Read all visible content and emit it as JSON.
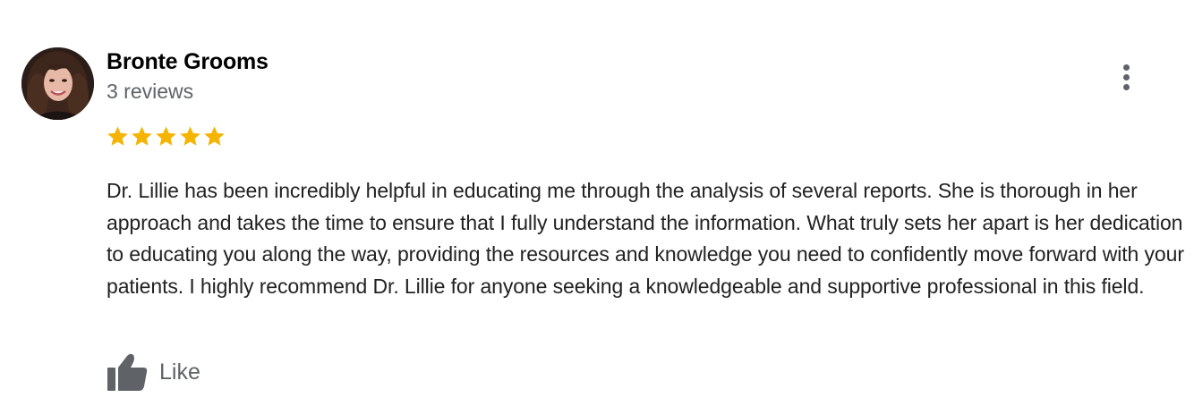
{
  "review": {
    "author": {
      "name": "Bronte Grooms",
      "review_count": "3 reviews",
      "avatar": "profile-photo"
    },
    "rating": 5,
    "rating_max": 5,
    "star_color": "#f4b400",
    "text": "Dr. Lillie has been incredibly helpful in educating me through the analysis of several reports. She is thorough in her approach and takes the time to ensure that I fully understand the information. What truly sets her apart is her dedication to educating you along the way, providing the resources and knowledge you need to confidently move forward with your patients. I highly recommend Dr. Lillie for anyone seeking a knowledgeable and supportive professional in this field.",
    "actions": {
      "like_label": "Like",
      "like_icon": "thumbs-up-icon",
      "more_icon": "more-vert-icon"
    }
  }
}
